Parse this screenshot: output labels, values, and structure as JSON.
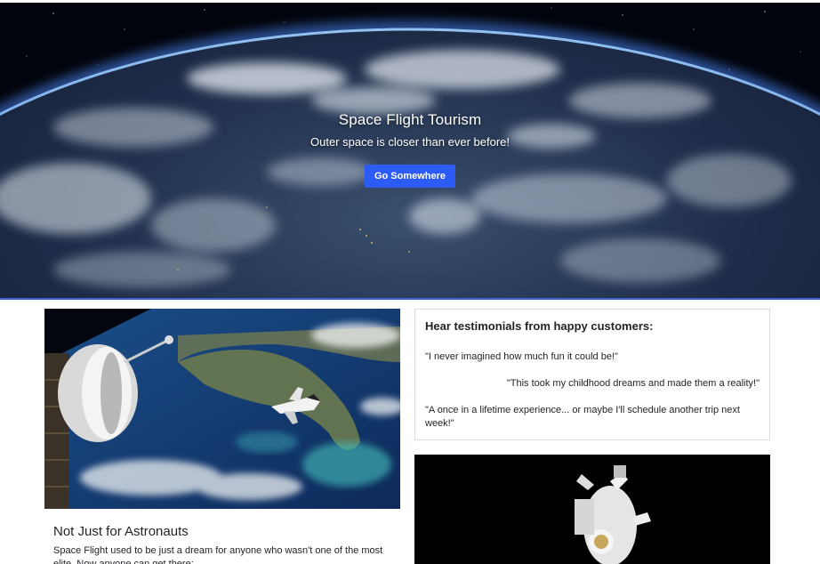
{
  "hero": {
    "title": "Space Flight Tourism",
    "subtitle": "Outer space is closer than ever before!",
    "button_label": "Go Somewhere",
    "button_color": "#2c5bf6"
  },
  "feature_card": {
    "title": "Not Just for Astronauts",
    "text": "Space Flight used to be just a dream for anyone who wasn't one of the most elite. Now anyone can get there:"
  },
  "testimonials": {
    "heading": "Hear testimonials from happy customers:",
    "quotes": [
      "\"I never imagined how much fun it could be!\"",
      "\"This took my childhood dreams and made them a reality!\"",
      "\"A once in a lifetime experience... or maybe I'll schedule another trip next week!\""
    ]
  },
  "colors": {
    "accent": "#2c5bf6",
    "hero_border": "#3f63d9"
  }
}
